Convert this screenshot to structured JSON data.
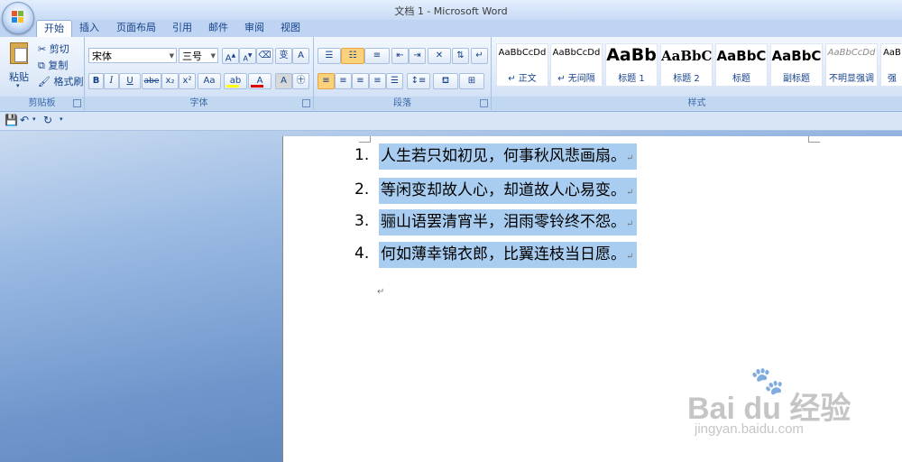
{
  "window": {
    "title": "文档 1 - Microsoft Word"
  },
  "tabs": [
    {
      "label": "开始",
      "active": true
    },
    {
      "label": "插入"
    },
    {
      "label": "页面布局"
    },
    {
      "label": "引用"
    },
    {
      "label": "邮件"
    },
    {
      "label": "审阅"
    },
    {
      "label": "视图"
    }
  ],
  "clipboard": {
    "group_label": "剪贴板",
    "paste_label": "粘贴",
    "cut_label": "剪切",
    "copy_label": "复制",
    "format_painter_label": "格式刷"
  },
  "font": {
    "group_label": "字体",
    "font_name": "宋体",
    "font_size": "三号",
    "grow_label": "A",
    "shrink_label": "A",
    "bold": "B",
    "italic": "I",
    "underline": "U",
    "strikethrough": "abe",
    "subscript": "x₂",
    "superscript": "x²",
    "change_case": "Aa",
    "font_color_label": "A",
    "char_border": "A",
    "phonetic": "变"
  },
  "paragraph": {
    "group_label": "段落"
  },
  "styles": {
    "group_label": "样式",
    "items": [
      {
        "sample": "AaBbCcDd",
        "name": "↵ 正文"
      },
      {
        "sample": "AaBbCcDd",
        "name": "↵ 无间隔"
      },
      {
        "sample": "AaBb",
        "name": "标题 1"
      },
      {
        "sample": "AaBbC",
        "name": "标题 2"
      },
      {
        "sample": "AaBbC",
        "name": "标题"
      },
      {
        "sample": "AaBbC",
        "name": "副标题"
      },
      {
        "sample": "AaBbCcDd",
        "name": "不明显强调"
      },
      {
        "sample": "AaB",
        "name": "强"
      }
    ]
  },
  "document": {
    "lines": [
      {
        "num": "1.",
        "text": "人生若只如初见，何事秋风悲画扇。"
      },
      {
        "num": "2.",
        "text": "等闲变却故人心，却道故人心易变。"
      },
      {
        "num": "3.",
        "text": "骊山语罢清宵半，泪雨零铃终不怨。"
      },
      {
        "num": "4.",
        "text": "何如薄幸锦衣郎，比翼连枝当日愿。"
      }
    ],
    "paragraph_mark": "↵"
  },
  "watermark": {
    "main": "Bai du 经验",
    "sub": "jingyan.baidu.com"
  },
  "colors": {
    "accent": "#15428b",
    "selection": "#a8cdf1",
    "font_color_bar": "#e00000",
    "highlight_bar": "#ffff00"
  },
  "icons": [
    "office-logo-icon",
    "paste-icon",
    "cut-icon",
    "copy-icon",
    "format-painter-icon",
    "save-icon",
    "undo-icon",
    "redo-icon",
    "bullets-icon",
    "numbering-icon",
    "align-left-icon",
    "align-center-icon",
    "align-right-icon",
    "justify-icon"
  ]
}
